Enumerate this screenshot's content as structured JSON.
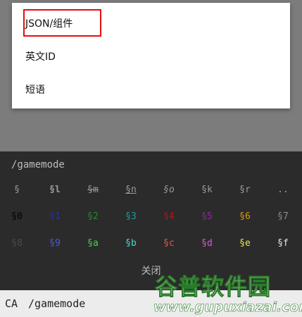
{
  "menu": {
    "items": [
      {
        "label": "JSON/组件"
      },
      {
        "label": "英文ID"
      },
      {
        "label": "短语"
      }
    ]
  },
  "panel": {
    "command_preview": "/gamemode",
    "format_codes_row1": [
      "§",
      "§l",
      "§m",
      "§n",
      "§o",
      "§k",
      "§r",
      ".."
    ],
    "format_codes_row2": [
      "§0",
      "§1",
      "§2",
      "§3",
      "§4",
      "§5",
      "§6",
      "§7"
    ],
    "format_codes_row3": [
      "§8",
      "§9",
      "§a",
      "§b",
      "§c",
      "§d",
      "§e",
      "§f"
    ],
    "close_label": "关闭"
  },
  "bottom_bar": {
    "ca_label": "CA",
    "input_value": "/gamemode"
  },
  "watermark": {
    "title": "谷普软件园",
    "url": "www.gupuxiazai.com"
  },
  "colors": {
    "highlight": "#e01010",
    "codes_row2": [
      "#000000",
      "#2233aa",
      "#1f8f2f",
      "#1e9aa0",
      "#b01818",
      "#8a2a9a",
      "#d89a10",
      "#8a8a8a"
    ],
    "codes_row3": [
      "#4a4a4a",
      "#4a5ad8",
      "#44d444",
      "#48d8d8",
      "#e85050",
      "#d858d8",
      "#e8e848",
      "#e8e8e8"
    ]
  }
}
